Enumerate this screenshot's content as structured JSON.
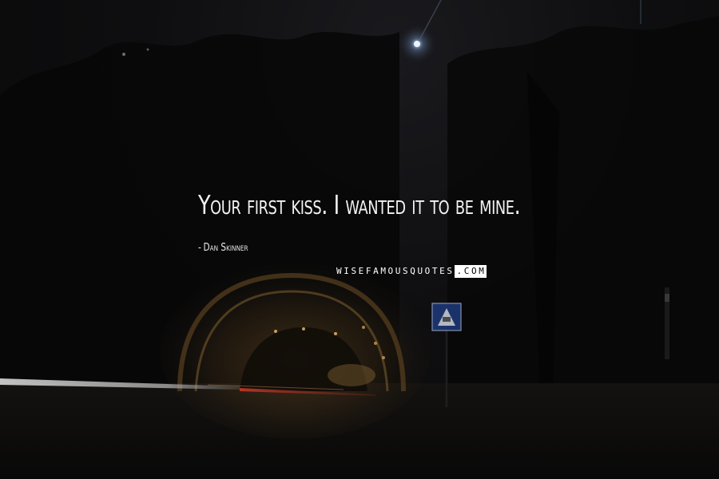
{
  "quote": {
    "text": "Your first kiss. I wanted it to be mine.",
    "author_dash": "-",
    "author": "Dan Skinner"
  },
  "watermark": {
    "light_part": "WISEFAMOUSQUOTES",
    "dark_part": ".COM"
  },
  "colors": {
    "text": "#f2f2f2",
    "background": "#0b0b0b",
    "tunnel_light": "#e0a040",
    "taillight_red": "#c83a2a"
  },
  "scene": {
    "elements": [
      "night-sky",
      "tree-silhouettes",
      "tunnel-entrance",
      "light-trails",
      "street-lamp",
      "pedestrian-crossing-sign"
    ]
  }
}
